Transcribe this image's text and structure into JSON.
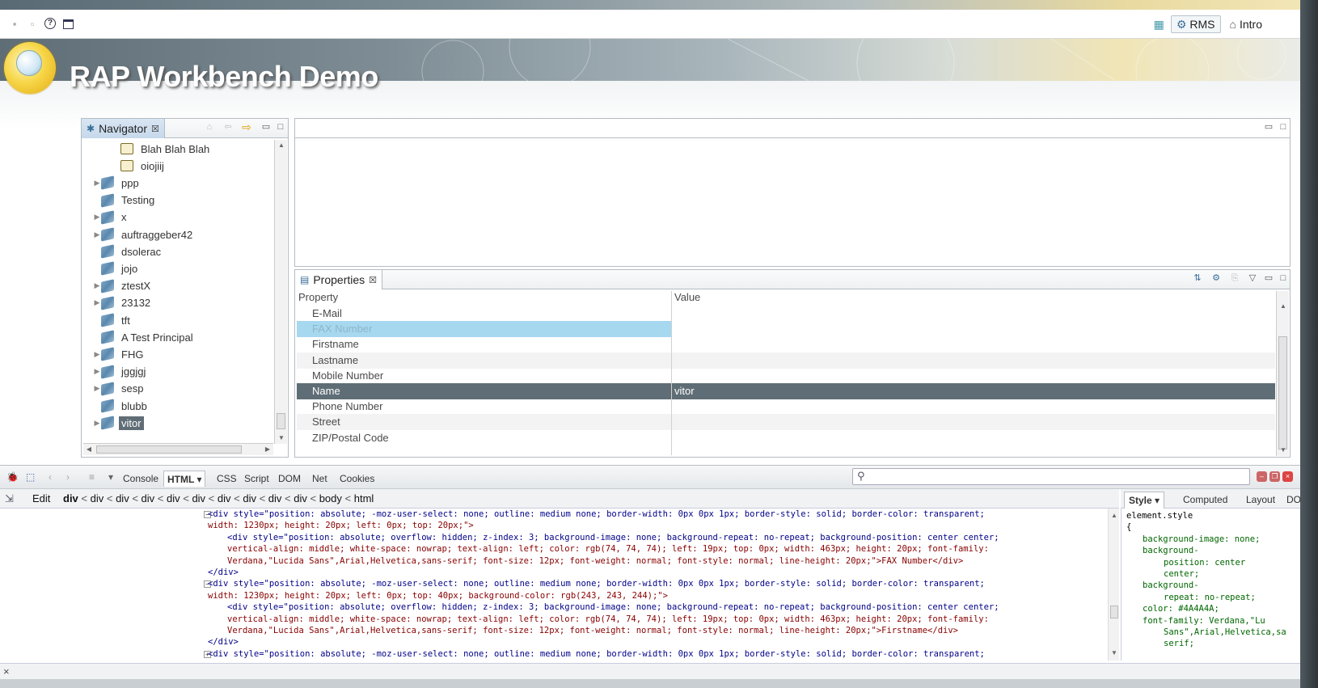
{
  "toolbar": {
    "perspectives": [
      {
        "label": "RMS",
        "active": true
      },
      {
        "label": "Intro",
        "active": false
      }
    ]
  },
  "banner": {
    "title": "RAP Workbench Demo"
  },
  "navigator": {
    "tab_label": "Navigator",
    "items": [
      {
        "label": "Blah Blah Blah",
        "icon": "folder-icon",
        "expandable": false,
        "indent": 1
      },
      {
        "label": "oiojiij",
        "icon": "folder-icon",
        "expandable": false,
        "indent": 1
      },
      {
        "label": "ppp",
        "icon": "book-icon",
        "expandable": true,
        "indent": 0
      },
      {
        "label": "Testing",
        "icon": "book-icon",
        "expandable": false,
        "indent": 0
      },
      {
        "label": "x",
        "icon": "book-icon",
        "expandable": true,
        "indent": 0
      },
      {
        "label": "auftraggeber42",
        "icon": "book-icon",
        "expandable": true,
        "indent": 0
      },
      {
        "label": "dsolerac",
        "icon": "book-icon",
        "expandable": false,
        "indent": 0
      },
      {
        "label": "jojo",
        "icon": "book-icon",
        "expandable": false,
        "indent": 0
      },
      {
        "label": "ztestX",
        "icon": "book-icon",
        "expandable": true,
        "indent": 0
      },
      {
        "label": "23132",
        "icon": "book-icon",
        "expandable": true,
        "indent": 0
      },
      {
        "label": "tft",
        "icon": "book-icon",
        "expandable": false,
        "indent": 0
      },
      {
        "label": "A Test Principal",
        "icon": "book-icon",
        "expandable": false,
        "indent": 0
      },
      {
        "label": "FHG",
        "icon": "book-icon",
        "expandable": true,
        "indent": 0
      },
      {
        "label": "jggjgj",
        "icon": "book-icon",
        "expandable": true,
        "indent": 0
      },
      {
        "label": "sesp",
        "icon": "book-icon",
        "expandable": true,
        "indent": 0
      },
      {
        "label": "blubb",
        "icon": "book-icon",
        "expandable": false,
        "indent": 0
      },
      {
        "label": "vitor",
        "icon": "book-icon",
        "expandable": true,
        "indent": 0,
        "selected": true
      }
    ]
  },
  "properties": {
    "tab_label": "Properties",
    "col_property": "Property",
    "col_value": "Value",
    "rows": [
      {
        "name": "E-Mail",
        "value": "",
        "state": "normal"
      },
      {
        "name": "FAX Number",
        "value": "",
        "state": "highlight"
      },
      {
        "name": "Firstname",
        "value": "",
        "state": "normal"
      },
      {
        "name": "Lastname",
        "value": "",
        "state": "alt"
      },
      {
        "name": "Mobile Number",
        "value": "",
        "state": "normal"
      },
      {
        "name": "Name",
        "value": "vitor",
        "state": "selected"
      },
      {
        "name": "Phone Number",
        "value": "",
        "state": "normal"
      },
      {
        "name": "Street",
        "value": "",
        "state": "alt"
      },
      {
        "name": "ZIP/Postal Code",
        "value": "",
        "state": "normal"
      }
    ]
  },
  "firebug": {
    "tabs": [
      "Console",
      "HTML",
      "CSS",
      "Script",
      "DOM",
      "Net",
      "Cookies"
    ],
    "selected_tab": "HTML",
    "search_placeholder": "",
    "edit_label": "Edit",
    "breadcrumb": [
      "div",
      "div",
      "div",
      "div",
      "div",
      "div",
      "div",
      "div",
      "div",
      "div",
      "body",
      "html"
    ],
    "side_tabs": [
      "Style",
      "Computed",
      "Layout",
      "DOM"
    ],
    "selected_side_tab": "Style",
    "code_lines": [
      {
        "twisty": "−",
        "indent": 0,
        "text": "<div style=\"position: absolute; -moz-user-select: none; outline: medium none; border-width: 0px 0px 1px; border-style: solid; border-color: transparent;"
      },
      {
        "twisty": "",
        "indent": 0,
        "text": "width: 1230px; height: 20px; left: 0px; top: 20px;\">"
      },
      {
        "twisty": "",
        "indent": 1,
        "text": "<div style=\"position: absolute; overflow: hidden; z-index: 3; background-image: none; background-repeat: no-repeat; background-position: center center;"
      },
      {
        "twisty": "",
        "indent": 1,
        "text": "vertical-align: middle; white-space: nowrap; text-align: left; color: rgb(74, 74, 74); left: 19px; top: 0px; width: 463px; height: 20px; font-family:"
      },
      {
        "twisty": "",
        "indent": 1,
        "text": "Verdana,\"Lucida Sans\",Arial,Helvetica,sans-serif; font-size: 12px; font-weight: normal; font-style: normal; line-height: 20px;\">FAX Number</div>"
      },
      {
        "twisty": "",
        "indent": 0,
        "text": "</div>"
      },
      {
        "twisty": "−",
        "indent": 0,
        "text": "<div style=\"position: absolute; -moz-user-select: none; outline: medium none; border-width: 0px 0px 1px; border-style: solid; border-color: transparent;"
      },
      {
        "twisty": "",
        "indent": 0,
        "text": "width: 1230px; height: 20px; left: 0px; top: 40px; background-color: rgb(243, 243, 244);\">"
      },
      {
        "twisty": "",
        "indent": 1,
        "text": "<div style=\"position: absolute; overflow: hidden; z-index: 3; background-image: none; background-repeat: no-repeat; background-position: center center;"
      },
      {
        "twisty": "",
        "indent": 1,
        "text": "vertical-align: middle; white-space: nowrap; text-align: left; color: rgb(74, 74, 74); left: 19px; top: 0px; width: 463px; height: 20px; font-family:"
      },
      {
        "twisty": "",
        "indent": 1,
        "text": "Verdana,\"Lucida Sans\",Arial,Helvetica,sans-serif; font-size: 12px; font-weight: normal; font-style: normal; line-height: 20px;\">Firstname</div>"
      },
      {
        "twisty": "",
        "indent": 0,
        "text": "</div>"
      },
      {
        "twisty": "+",
        "indent": 0,
        "text": "<div style=\"position: absolute; -moz-user-select: none; outline: medium none; border-width: 0px 0px 1px; border-style: solid; border-color: transparent;"
      }
    ],
    "style_lines": [
      {
        "indent": 0,
        "text": "element.style"
      },
      {
        "indent": 0,
        "text": "{"
      },
      {
        "indent": 1,
        "text": "background-image: none;"
      },
      {
        "indent": 1,
        "text": "background-"
      },
      {
        "indent": 2,
        "text": "position: center"
      },
      {
        "indent": 2,
        "text": "center;"
      },
      {
        "indent": 1,
        "text": "background-"
      },
      {
        "indent": 2,
        "text": "repeat: no-repeat;"
      },
      {
        "indent": 1,
        "text": "color: #4A4A4A;"
      },
      {
        "indent": 1,
        "text": "font-family: Verdana,\"Lu"
      },
      {
        "indent": 2,
        "text": "Sans\",Arial,Helvetica,sa"
      },
      {
        "indent": 2,
        "text": "serif;"
      }
    ],
    "status_close": "×"
  }
}
